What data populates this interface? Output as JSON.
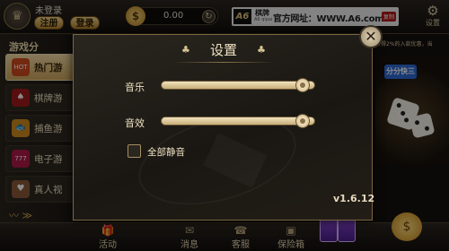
{
  "header": {
    "login_status": "未登录",
    "register_label": "注册",
    "login_label": "登录",
    "balance": "0.00",
    "brand_logo": "A6",
    "brand_name": "棋牌",
    "brand_sub": "A6 qipai",
    "brand_site": "官方网址：WWW.A6.com",
    "brand_tag": "复制",
    "settings_label": "设置"
  },
  "sidebar": {
    "title": "游戏分",
    "items": [
      {
        "label": "热门游",
        "icon": "HOT",
        "color": "#d14a1e"
      },
      {
        "label": "棋牌游",
        "icon": "♠",
        "color": "#a11a1a"
      },
      {
        "label": "捕鱼游",
        "icon": "🐟",
        "color": "#d08a1e"
      },
      {
        "label": "电子游",
        "icon": "777",
        "color": "#b0184a"
      },
      {
        "label": "真人视",
        "icon": "♥",
        "color": "#8a5a3a"
      }
    ]
  },
  "notice": "获得2%的入款优惠，当",
  "promo": {
    "tag": "分分快三"
  },
  "bottom_nav": [
    {
      "label": "活动",
      "icon": "🎁"
    },
    {
      "label": "消息",
      "icon": "✉"
    },
    {
      "label": "客服",
      "icon": "☎"
    },
    {
      "label": "保险箱",
      "icon": "▣"
    }
  ],
  "modal": {
    "title": "设置",
    "suit_left": "♣",
    "suit_right": "♣",
    "music_label": "音乐",
    "music_level": 0.97,
    "sfx_label": "音效",
    "sfx_level": 0.97,
    "mute_label": "全部静音",
    "mute_checked": false,
    "close_symbol": "✕",
    "version": "v1.6.12"
  },
  "colors": {
    "accent_gold": "#e6c47a",
    "panel_bg": "#1f1b16",
    "text_cream": "#efe2c2"
  }
}
